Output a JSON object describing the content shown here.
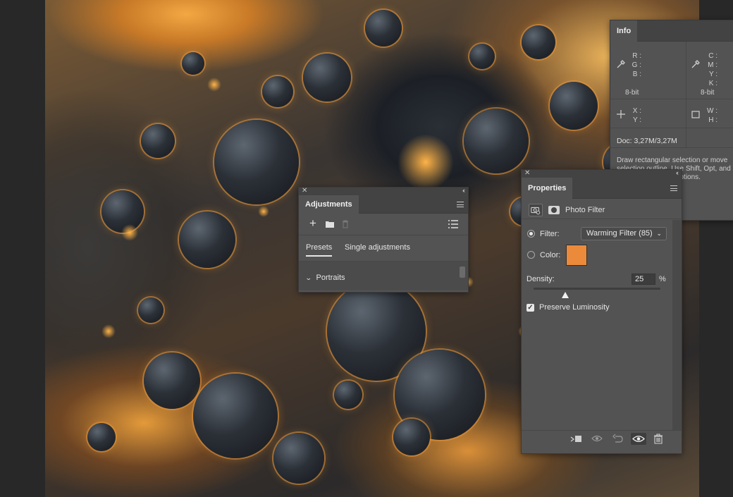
{
  "info": {
    "tab": "Info",
    "rgb_labels": [
      "R :",
      "G :",
      "B :"
    ],
    "cmyk_labels": [
      "C :",
      "M :",
      "Y :",
      "K :"
    ],
    "bit_left": "8-bit",
    "bit_right": "8-bit",
    "xy_labels": [
      "X :",
      "Y :"
    ],
    "wh_labels": [
      "W :",
      "H :"
    ],
    "doc": "Doc: 3,27M/3,27M",
    "hint": "Draw rectangular selection or move selection outline. Use Shift, Opt, and Cmd for additional options."
  },
  "adjustments": {
    "tab": "Adjustments",
    "subtabs": [
      "Presets",
      "Single adjustments"
    ],
    "active_subtab": "Presets",
    "list_item": "Portraits",
    "tools": [
      "add-icon",
      "folder-icon",
      "trash-icon",
      "list-view-icon"
    ]
  },
  "properties": {
    "tab": "Properties",
    "layer_type": "Photo Filter",
    "filter_label": "Filter:",
    "filter_value": "Warming Filter (85)",
    "filter_selected": true,
    "color_label": "Color:",
    "color_value": "#ec8a3b",
    "density_label": "Density:",
    "density_value": "25",
    "density_unit": "%",
    "density_fraction": 0.25,
    "preserve_label": "Preserve Luminosity",
    "preserve_checked": true,
    "footer_icons": [
      "clip-to-layer-icon",
      "view-previous-icon",
      "reset-icon",
      "visibility-icon",
      "delete-icon"
    ]
  }
}
